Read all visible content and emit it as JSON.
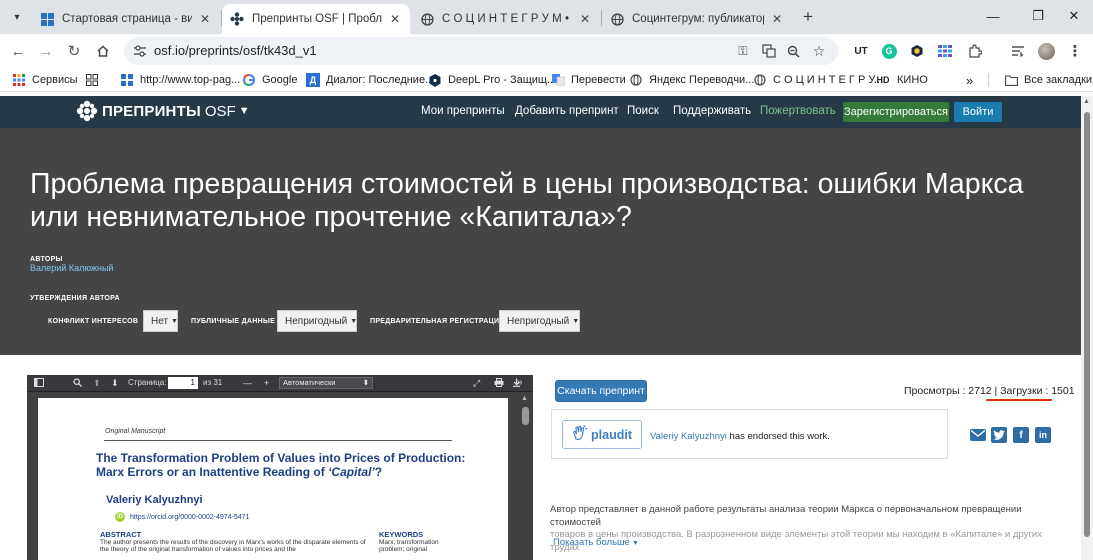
{
  "browser": {
    "tabs": [
      {
        "title": "Стартовая страница - визуальные закладки",
        "icon": "speeddial-icon"
      },
      {
        "title": "Препринты OSF | Проблема превращения",
        "icon": "osf-icon"
      },
      {
        "title": "С О Ц И Н Т Е Г Р У М • Просмотр",
        "icon": "globe-icon"
      },
      {
        "title": "Социнтегрум: публикатор карт",
        "icon": "globe-icon"
      }
    ],
    "url": "osf.io/preprints/osf/tk43d_v1",
    "bookmarks": [
      {
        "label": "Сервисы",
        "icon": "apps-icon"
      },
      {
        "label": "",
        "icon": "grid-icon"
      },
      {
        "label": "http://www.top-pag...",
        "icon": "speeddial-icon"
      },
      {
        "label": "Google",
        "icon": "google-icon"
      },
      {
        "label": "Диалог: Последние...",
        "icon": "dialog-icon"
      },
      {
        "label": "DeepL Pro - Защищ...",
        "icon": "deepl-icon"
      },
      {
        "label": "Перевести",
        "icon": "translate-icon"
      },
      {
        "label": "Яндекс Переводчи...",
        "icon": "globe-icon"
      },
      {
        "label": "С О Ц И Н Т Е Г Р У...",
        "icon": "globe-icon"
      },
      {
        "label": "КИНО",
        "icon": "hd-icon"
      }
    ],
    "more_bookmarks": "»",
    "all_bookmarks": "Все закладки",
    "hd_badge": "HD",
    "ext_ut": "UT",
    "ext_g": "G"
  },
  "osf": {
    "brand": "ПРЕПРИНТЫ",
    "brand2": "OSF",
    "nav": {
      "my_preprints": "Мои препринты",
      "add_preprint": "Добавить препринт",
      "search": "Поиск",
      "support": "Поддерживать",
      "donate": "Пожертвовать",
      "register": "Зарегистрироваться",
      "login": "Войти"
    },
    "title": "Проблема превращения стоимостей в цены производства: ошибки Маркса или невнимательное прочтение «Капитала»?",
    "authors_label": "АВТОРЫ",
    "author": "Валерий Калюжный",
    "assertions_label": "УТВЕРЖДЕНИЯ АВТОРА",
    "coi_label": "КОНФЛИКТ ИНТЕРЕСОВ",
    "coi_value": "Нет",
    "public_data_label": "ПУБЛИЧНЫЕ ДАННЫЕ",
    "public_data_value": "Непригодный",
    "prereg_label": "ПРЕДВАРИТЕЛЬНАЯ РЕГИСТРАЦИЯ",
    "prereg_value": "Непригодный"
  },
  "pdf": {
    "page_label": "Страница:",
    "page_value": "1",
    "page_total": "из 31",
    "zoom": "Автоматически",
    "doc": {
      "label": "Original Manuscript",
      "title_part1": "The Transformation Problem of Values into Prices of Production: Marx Errors or an Inattentive Reading of ",
      "title_capital": "‘Capital’",
      "title_end": "?",
      "author": "Valeriy Kalyuzhnyi",
      "orcid": "https://orcid.org/0000-0002-4974-5471",
      "orcid_badge": "iD",
      "abstract_h": "ABSTRACT",
      "abstract_t": "The author presents the results of the discovery in Marx's works of the disparate elements of the theory of the original transformation of values into prices and the",
      "keywords_h": "KEYWORDS",
      "keywords_t": "Marx; transformation problem; original"
    }
  },
  "sidebar": {
    "download": "Скачать препринт",
    "views_label": "Просмотры",
    "views": "2712",
    "downloads_label": "Загрузки",
    "downloads": "1501",
    "plaudit_label": "plaudit",
    "endorser": "Valeriy Kalyuzhnyi",
    "endorsed_text": " has endorsed this work.",
    "share_icons": [
      "email-icon",
      "twitter-icon",
      "facebook-icon",
      "linkedin-icon"
    ],
    "abstract_line1": "Автор представляет в данной работе результаты анализа теории Маркса о первоначальном превращении стоимостей",
    "abstract_line2": "товаров в цены производства. В разрозненном виде элементы этой теории мы находим в «Капитале» и других трудах",
    "show_more": "Показать больше"
  },
  "colors": {
    "osf_nav": "#263947",
    "hero": "#454545",
    "register_btn": "#357a38",
    "login_btn": "#1b7daf",
    "donate": "#7ac58a",
    "link": "#337ab7",
    "downloads_underline": "#dd3311"
  }
}
